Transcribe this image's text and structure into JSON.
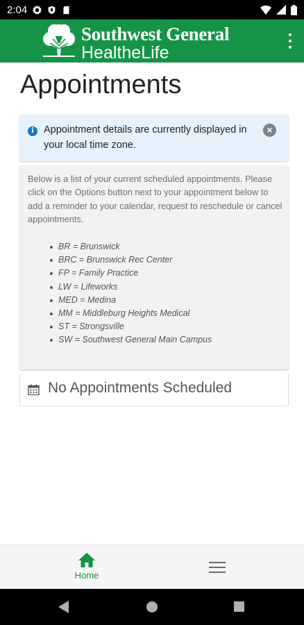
{
  "status_bar": {
    "time": "2:04",
    "left_icons": [
      "settings-icon",
      "shield-icon",
      "sd-card-icon"
    ],
    "right_icons": [
      "wifi-icon",
      "signal-icon",
      "battery-icon"
    ]
  },
  "header": {
    "brand_line1": "Southwest General",
    "brand_line2": "HealtheLife",
    "logo": "tree-logo",
    "menu_icon": "kebab-menu-icon",
    "background_color": "#159447"
  },
  "page": {
    "title": "Appointments"
  },
  "info_alert": {
    "text": "Appointment details are currently displayed in your local time zone.",
    "icon": "info-icon",
    "close_label": "×"
  },
  "info_card": {
    "description": "Below is a list of your current scheduled appointments. Please click on the Options button next to your appointment below to add a reminder to your calendar, request to reschedule or cancel appointments.",
    "legend": [
      "BR = Brunswick",
      "BRC = Brunswick Rec Center",
      "FP = Family Practice",
      "LW = Lifeworks",
      "MED = Medina",
      "MM = Middleburg Heights Medical",
      "ST = Strongsville",
      "SW = Southwest General Main Campus"
    ]
  },
  "appointments": {
    "empty_text": "No Appointments Scheduled",
    "icon": "calendar-icon"
  },
  "bottom_nav": {
    "home_label": "Home",
    "home_icon": "home-icon",
    "menu_icon": "hamburger-menu-icon",
    "active_color": "#159447"
  },
  "system_nav": {
    "buttons": [
      "back",
      "home",
      "recents"
    ]
  }
}
